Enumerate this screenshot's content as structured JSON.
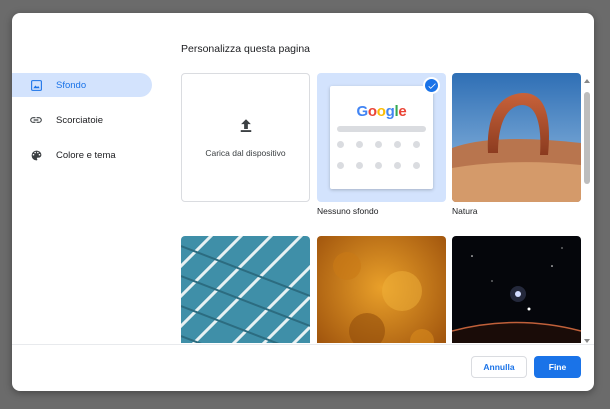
{
  "dialog": {
    "title": "Personalizza questa pagina"
  },
  "sidebar": {
    "items": [
      {
        "label": "Sfondo",
        "icon": "image-icon",
        "active": true
      },
      {
        "label": "Scorciatoie",
        "icon": "link-icon",
        "active": false
      },
      {
        "label": "Colore e tema",
        "icon": "palette-icon",
        "active": false
      }
    ]
  },
  "backgrounds": {
    "upload_label": "Carica dal dispositivo",
    "tiles": [
      {
        "label": "Nessuno sfondo",
        "selected": true
      },
      {
        "label": "Natura",
        "selected": false
      }
    ],
    "preview_logo": "Google"
  },
  "footer": {
    "cancel_label": "Annulla",
    "done_label": "Fine"
  },
  "colors": {
    "accent": "#1a73e8",
    "selected_bg": "#d3e3fd"
  }
}
